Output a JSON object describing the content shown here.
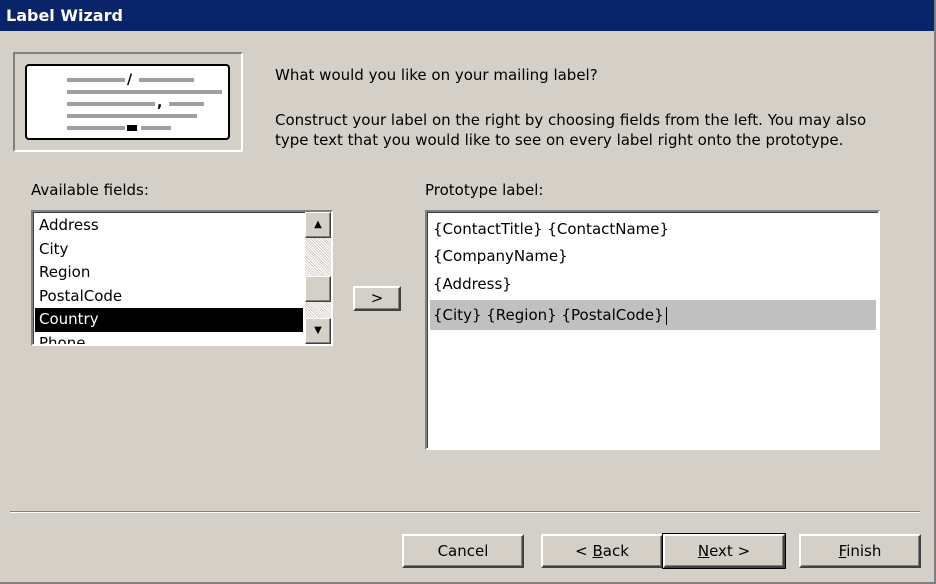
{
  "window": {
    "title": "Label Wizard"
  },
  "intro": {
    "question": "What would you like on your mailing label?",
    "line1": "Construct your label on the right by choosing fields from the left. You may also",
    "line2": "type text that you would like to see on every label right onto the prototype."
  },
  "available": {
    "label": "Available fields:",
    "items": [
      {
        "text": "Address",
        "selected": false
      },
      {
        "text": "City",
        "selected": false
      },
      {
        "text": "Region",
        "selected": false
      },
      {
        "text": "PostalCode",
        "selected": false
      },
      {
        "text": "Country",
        "selected": true
      },
      {
        "text": "Phone",
        "selected": false
      }
    ]
  },
  "add_button": {
    "label": ">"
  },
  "prototype": {
    "label": "Prototype label:",
    "lines": [
      "{ContactTitle} {ContactName}",
      "{CompanyName}",
      "{Address}",
      "{City}  {Region}  {PostalCode}"
    ],
    "highlighted_line": 3
  },
  "buttons": {
    "cancel": "Cancel",
    "back": {
      "prefix": "< ",
      "access": "B",
      "rest": "ack"
    },
    "next": {
      "access": "N",
      "rest": "ext >"
    },
    "finish": {
      "access": "F",
      "rest": "inish"
    }
  },
  "icons": {
    "scroll_up": "scroll-up-arrow",
    "scroll_down": "scroll-down-arrow",
    "label_art": "mailing-label-illustration"
  },
  "colors": {
    "titlebar": "#0a246a",
    "face": "#d4d0c8",
    "selection": "#000000",
    "highlight_line": "#c0c0c0"
  }
}
